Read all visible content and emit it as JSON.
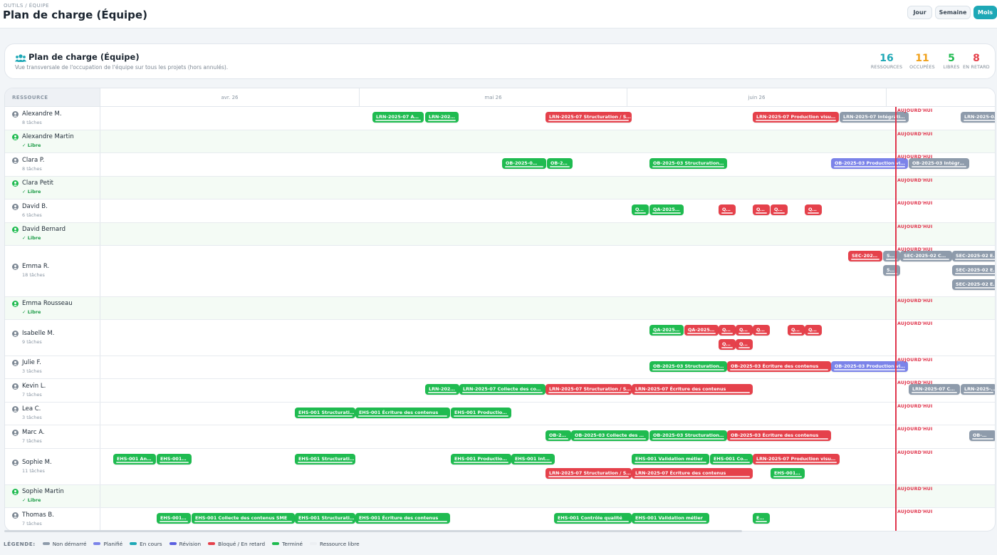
{
  "header": {
    "breadcrumb": "OUTILS / ÉQUIPE",
    "title": "Plan de charge (Équipe)",
    "views": [
      {
        "label": "Jour",
        "active": false
      },
      {
        "label": "Semaine",
        "active": false
      },
      {
        "label": "Mois",
        "active": true
      }
    ]
  },
  "summary": {
    "icon": "users-icon",
    "title": "Plan de charge (Équipe)",
    "subtitle": "Vue transversale de l'occupation de l'équipe sur tous les projets (hors annulés).",
    "stats": [
      {
        "value": "16",
        "label": "RESSOURCES",
        "color": "#1ea8b6"
      },
      {
        "value": "11",
        "label": "OCCUPÉES",
        "color": "#f0a11c"
      },
      {
        "value": "5",
        "label": "LIBRES",
        "color": "#1fbb50"
      },
      {
        "value": "8",
        "label": "EN RETARD",
        "color": "#e5414b"
      }
    ]
  },
  "grid": {
    "resource_header": "RESSOURCE",
    "months": [
      "avr. 26",
      "mai 26",
      "juin 26"
    ],
    "today_label": "AUJOURD'HUI",
    "free_label": "✓ Libre",
    "rows": [
      {
        "name": "Alexandre M.",
        "sub": "8 tâches",
        "free": false,
        "bars": [
          {
            "label": "LRN-2025-07 A…",
            "status": "done"
          },
          {
            "label": "LRN-202…",
            "status": "done"
          },
          {
            "label": "LRN-2025-07 Structuration / S…",
            "status": "late"
          },
          {
            "label": "LRN-2025-07 Production visu…",
            "status": "late"
          },
          {
            "label": "LRN-2025-07 Intégrati…",
            "status": "todo"
          },
          {
            "label": "LRN-2025-0…",
            "status": "todo"
          }
        ]
      },
      {
        "name": "Alexandre Martin",
        "sub": "✓ Libre",
        "free": true,
        "bars": []
      },
      {
        "name": "Clara P.",
        "sub": "8 tâches",
        "free": false,
        "bars": [
          {
            "label": "OB-2025-0…",
            "status": "done"
          },
          {
            "label": "OB-2…",
            "status": "done"
          },
          {
            "label": "OB-2025-03 Structuration…",
            "status": "done"
          },
          {
            "label": "OB-2025-03 Production vi…",
            "status": "planned"
          },
          {
            "label": "OB-2025-03 Intégr…",
            "status": "todo"
          }
        ]
      },
      {
        "name": "Clara Petit",
        "sub": "✓ Libre",
        "free": true,
        "bars": []
      },
      {
        "name": "David B.",
        "sub": "6 tâches",
        "free": false,
        "bars": [
          {
            "label": "Q…",
            "status": "done"
          },
          {
            "label": "QA-2025…",
            "status": "done"
          },
          {
            "label": "Q…",
            "status": "late"
          },
          {
            "label": "Q…",
            "status": "late"
          },
          {
            "label": "Q…",
            "status": "late"
          },
          {
            "label": "Q…",
            "status": "late"
          }
        ]
      },
      {
        "name": "David Bernard",
        "sub": "✓ Libre",
        "free": true,
        "bars": []
      },
      {
        "name": "Emma R.",
        "sub": "18 tâches",
        "free": false,
        "bars": [
          {
            "label": "SEC-202…",
            "status": "late"
          },
          {
            "label": "S…",
            "status": "todo"
          },
          {
            "label": "SEC-2025-02 C…",
            "status": "todo"
          },
          {
            "label": "SEC-2025-02 E…",
            "status": "todo"
          },
          {
            "label": "S…",
            "status": "todo"
          },
          {
            "label": "SEC-2025-02 E…",
            "status": "todo"
          },
          {
            "label": "SEC-2025-02 E…",
            "status": "todo"
          }
        ]
      },
      {
        "name": "Emma Rousseau",
        "sub": "✓ Libre",
        "free": true,
        "bars": []
      },
      {
        "name": "Isabelle M.",
        "sub": "9 tâches",
        "free": false,
        "bars": [
          {
            "label": "QA-2025…",
            "status": "done"
          },
          {
            "label": "QA-2025…",
            "status": "late"
          },
          {
            "label": "Q…",
            "status": "late"
          },
          {
            "label": "Q…",
            "status": "late"
          },
          {
            "label": "Q…",
            "status": "late"
          },
          {
            "label": "Q…",
            "status": "late"
          },
          {
            "label": "Q…",
            "status": "late"
          },
          {
            "label": "Q…",
            "status": "late"
          },
          {
            "label": "Q…",
            "status": "late"
          }
        ]
      },
      {
        "name": "Julie F.",
        "sub": "3 tâches",
        "free": false,
        "bars": [
          {
            "label": "OB-2025-03 Structuration…",
            "status": "done"
          },
          {
            "label": "OB-2025-03 Écriture des contenus",
            "status": "late"
          },
          {
            "label": "OB-2025-03 Production vi…",
            "status": "planned"
          }
        ]
      },
      {
        "name": "Kevin L.",
        "sub": "7 tâches",
        "free": false,
        "bars": [
          {
            "label": "LRN-202…",
            "status": "done"
          },
          {
            "label": "LRN-2025-07 Collecte des co…",
            "status": "done"
          },
          {
            "label": "LRN-2025-07 Structuration / S…",
            "status": "late"
          },
          {
            "label": "LRN-2025-07 Écriture des contenus",
            "status": "late"
          },
          {
            "label": "LRN-2025-07 C…",
            "status": "todo"
          },
          {
            "label": "LRN-2025-…",
            "status": "todo"
          }
        ]
      },
      {
        "name": "Lea C.",
        "sub": "3 tâches",
        "free": false,
        "bars": [
          {
            "label": "EHS-001 Structurati…",
            "status": "done"
          },
          {
            "label": "EHS-001 Écriture des contenus",
            "status": "done"
          },
          {
            "label": "EHS-001 Productio…",
            "status": "done"
          }
        ]
      },
      {
        "name": "Marc A.",
        "sub": "7 tâches",
        "free": false,
        "bars": [
          {
            "label": "OB-2…",
            "status": "done"
          },
          {
            "label": "OB-2025-03 Collecte des …",
            "status": "done"
          },
          {
            "label": "OB-2025-03 Structuration…",
            "status": "done"
          },
          {
            "label": "OB-2025-03 Écriture des contenus",
            "status": "late"
          },
          {
            "label": "OB-…",
            "status": "todo"
          }
        ]
      },
      {
        "name": "Sophie M.",
        "sub": "11 tâches",
        "free": false,
        "bars": [
          {
            "label": "EHS-001 An…",
            "status": "done"
          },
          {
            "label": "EHS-001…",
            "status": "done"
          },
          {
            "label": "EHS-001 Structurati…",
            "status": "done"
          },
          {
            "label": "EHS-001 Productio…",
            "status": "done"
          },
          {
            "label": "EHS-001 Int…",
            "status": "done"
          },
          {
            "label": "EHS-001 Validation métier",
            "status": "done"
          },
          {
            "label": "EHS-001 Co…",
            "status": "done"
          },
          {
            "label": "LRN-2025-07 Production visu…",
            "status": "late"
          },
          {
            "label": "LRN-2025-07 Structuration / S…",
            "status": "late"
          },
          {
            "label": "LRN-2025-07 Écriture des contenus",
            "status": "late"
          },
          {
            "label": "EHS-001…",
            "status": "done"
          }
        ]
      },
      {
        "name": "Sophie Martin",
        "sub": "✓ Libre",
        "free": true,
        "bars": []
      },
      {
        "name": "Thomas B.",
        "sub": "7 tâches",
        "free": false,
        "bars": [
          {
            "label": "EHS-001…",
            "status": "done"
          },
          {
            "label": "EHS-001 Collecte des contenus SME",
            "status": "done"
          },
          {
            "label": "EHS-001 Structurati…",
            "status": "done"
          },
          {
            "label": "EHS-001 Écriture des contenus",
            "status": "done"
          },
          {
            "label": "EHS-001 Contrôle qualité",
            "status": "done"
          },
          {
            "label": "EHS-001 Validation métier",
            "status": "done"
          },
          {
            "label": "E…",
            "status": "done"
          }
        ]
      }
    ]
  },
  "legend": {
    "title": "LÉGENDE:",
    "items": [
      {
        "label": "Non démarré",
        "color": "#8e9bab"
      },
      {
        "label": "Planifié",
        "color": "#7b83e9"
      },
      {
        "label": "En cours",
        "color": "#1ea8b6"
      },
      {
        "label": "Révision",
        "color": "#5a5fe0"
      },
      {
        "label": "Bloqué / En retard",
        "color": "#e5414b"
      },
      {
        "label": "Terminé",
        "color": "#1fbb50"
      },
      {
        "label": "Ressource libre",
        "color": "#eceff3"
      }
    ]
  }
}
